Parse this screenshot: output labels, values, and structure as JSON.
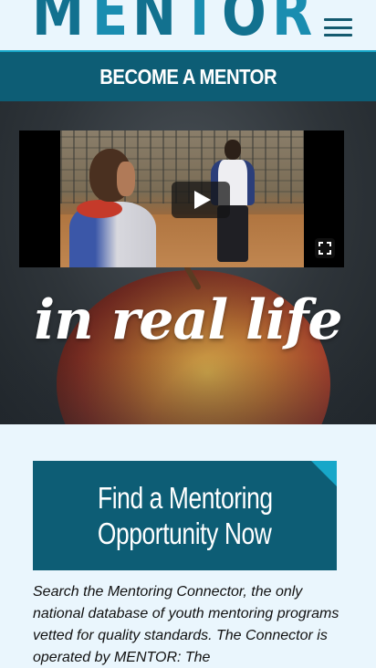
{
  "header": {
    "logo_letters": [
      "M",
      "E",
      "N",
      "T",
      "O",
      "R"
    ],
    "logo_alt": "MENTOR",
    "menu_icon": "hamburger-menu-icon"
  },
  "become_bar": {
    "label": "BECOME A MENTOR"
  },
  "hero": {
    "tagline": "in real life",
    "video": {
      "play_icon": "play-icon",
      "fullscreen_icon": "fullscreen-icon"
    }
  },
  "find_card": {
    "line1": "Find a Mentoring",
    "line2": "Opportunity Now"
  },
  "description": "Search the Mentoring Connector, the only national database of youth mentoring programs vetted for quality standards. The Connector is operated by MENTOR: The",
  "colors": {
    "brand_dark": "#0d5d75",
    "brand_accent": "#17a7c9",
    "logo_teal": "#12718f",
    "page_bg": "#eaf6fd"
  }
}
